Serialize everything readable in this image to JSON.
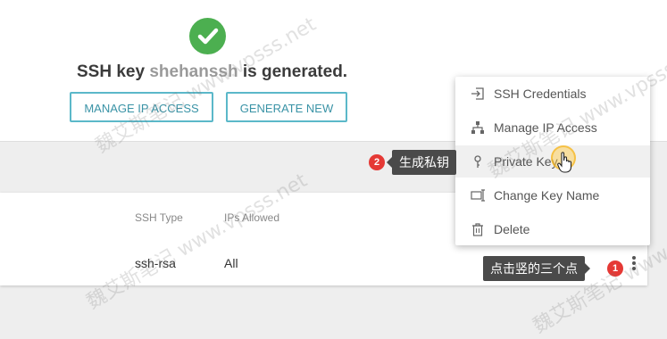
{
  "banner": {
    "message_prefix": "SSH key ",
    "username": "shehanssh",
    "message_suffix": " is generated.",
    "manage_ip_label": "MANAGE IP ACCESS",
    "generate_new_label": "GENERATE NEW"
  },
  "table": {
    "headers": [
      "SSH Type",
      "IPs Allowed"
    ],
    "row": [
      "ssh-rsa",
      "All"
    ]
  },
  "menu": {
    "items": [
      {
        "label": "SSH Credentials",
        "icon": "login-icon"
      },
      {
        "label": "Manage IP Access",
        "icon": "network-icon"
      },
      {
        "label": "Private Key",
        "icon": "key-icon"
      },
      {
        "label": "Change Key Name",
        "icon": "rename-icon"
      },
      {
        "label": "Delete",
        "icon": "trash-icon"
      }
    ]
  },
  "annotations": {
    "private_key_tip": "生成私钥",
    "dots_tip": "点击竖的三个点",
    "badge_1": "1",
    "badge_2": "2"
  },
  "watermark": {
    "text": "魏艾斯笔记 www.vpsss.net"
  },
  "colors": {
    "success": "#4caf50",
    "button_border": "#5bb8c9",
    "badge": "#e53935",
    "tooltip": "#4a4a4a"
  }
}
